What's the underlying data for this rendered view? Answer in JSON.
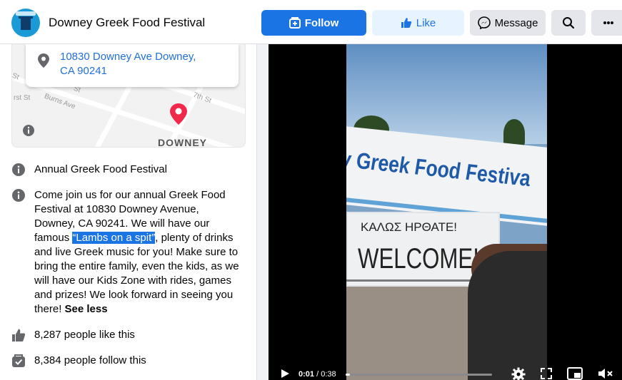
{
  "header": {
    "page_name": "Downey Greek Food Festival",
    "follow_label": "Follow",
    "like_label": "Like",
    "message_label": "Message",
    "brand_color": "#1b74e4"
  },
  "about": {
    "address_line1": "10830 Downey Ave Downey,",
    "address_line2": "CA 90241",
    "map": {
      "streets": [
        "Burns Ave",
        "7th St",
        "St",
        "St",
        "rst St"
      ],
      "city_label": "DOWNEY"
    },
    "category": "Annual Greek Food Festival",
    "description": {
      "before": "Come join us for our annual Greek Food Festival at 10830 Downey Avenue, Downey, CA 90241. We will have our famous ",
      "highlight": "“Lambs on a spit”",
      "after": ", plenty of drinks and live Greek music for you! Make sure to bring the entire family, even the kids, as we will have our Kids Zone with rides, games and prizes! We look forward in seeing you there!",
      "see_less": "See less"
    },
    "likes": "8,287 people like this",
    "follows": "8,384 people follow this"
  },
  "video": {
    "current_time": "0:01",
    "duration": "/ 0:38",
    "progress_fraction": 0.03,
    "banner_text": "y Greek Food Festiva",
    "sign_sub": "ΚΑΛΩΣ ΗΡΘΑΤΕ!",
    "sign_main": "WELCOME!"
  }
}
